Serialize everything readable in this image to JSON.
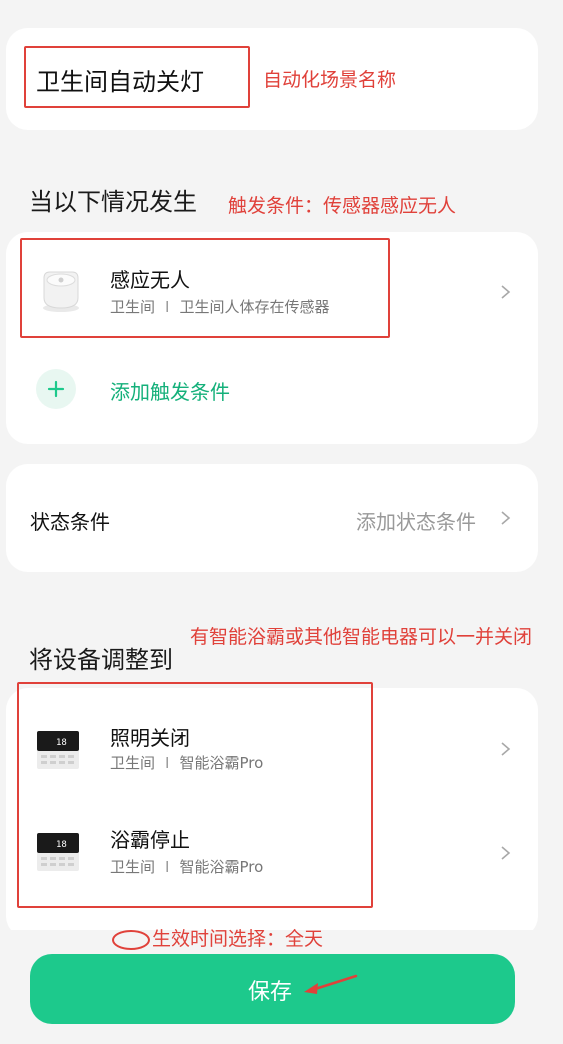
{
  "scene": {
    "name": "卫生间自动关灯",
    "name_annotation": "自动化场景名称"
  },
  "trigger": {
    "section_title": "当以下情况发生",
    "annotation": "触发条件：传感器感应无人",
    "item": {
      "title": "感应无人",
      "room": "卫生间",
      "device": "卫生间人体存在传感器"
    },
    "add_label": "添加触发条件"
  },
  "status": {
    "label": "状态条件",
    "add_label": "添加状态条件"
  },
  "actions": {
    "section_title": "将设备调整到",
    "annotation": "有智能浴霸或其他智能电器可以一并关闭",
    "items": [
      {
        "title": "照明关闭",
        "room": "卫生间",
        "device": "智能浴霸Pro"
      },
      {
        "title": "浴霸停止",
        "room": "卫生间",
        "device": "智能浴霸Pro"
      }
    ]
  },
  "footer": {
    "effective_time_annotation": "生效时间选择：全天",
    "save_label": "保存"
  },
  "colors": {
    "accent_green": "#1dc98c",
    "annotation_red": "#e0413a"
  }
}
